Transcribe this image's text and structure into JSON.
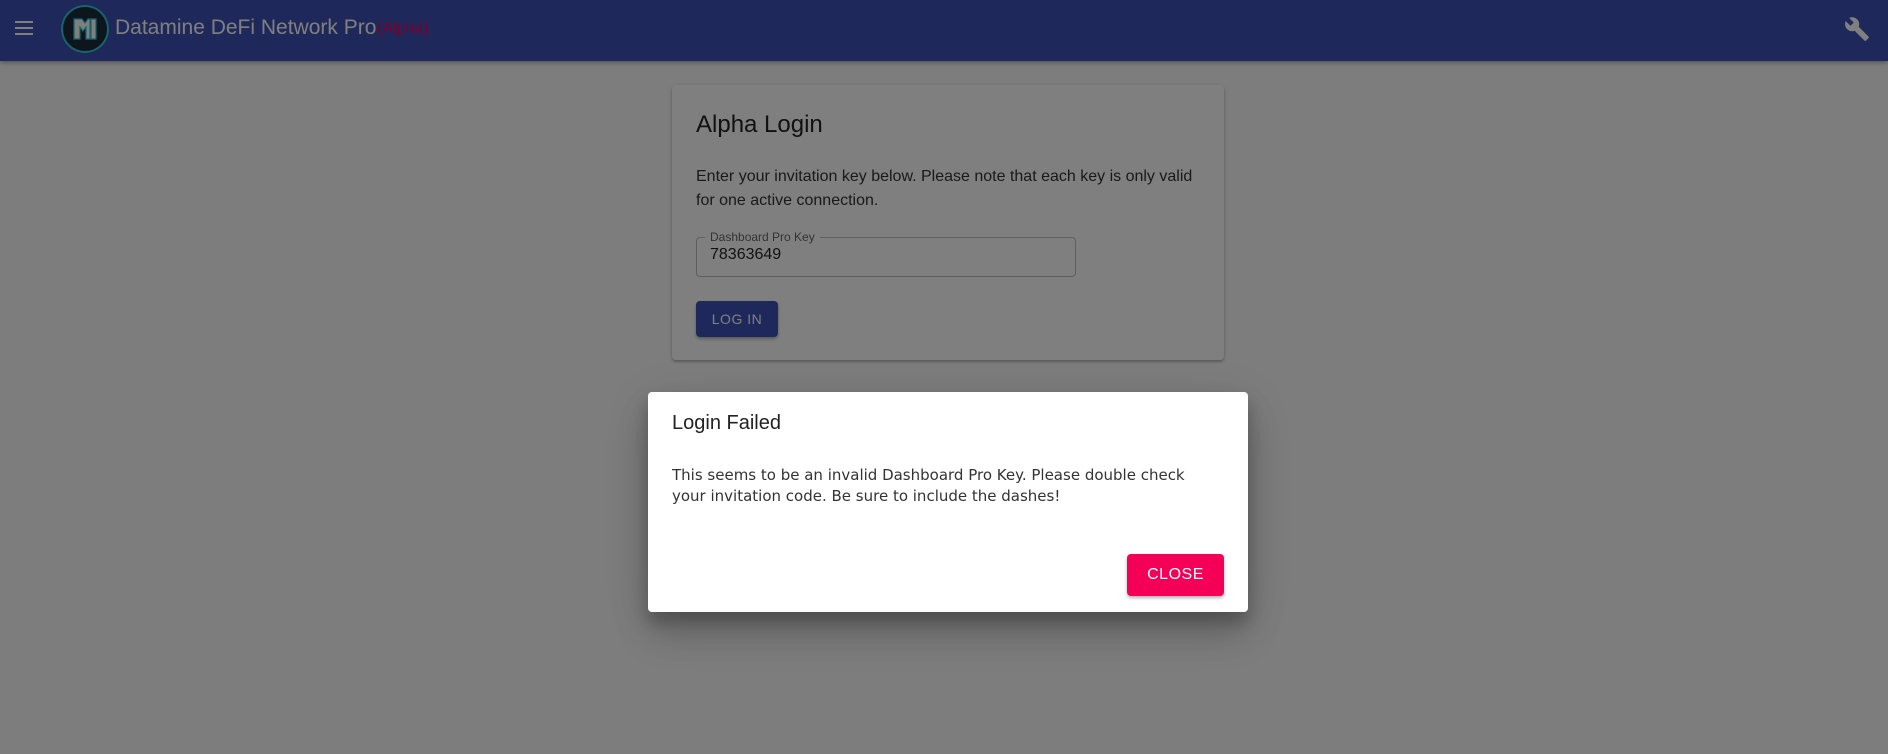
{
  "appbar": {
    "title": "Datamine DeFi Network Pro",
    "badge": "(Alpha)",
    "menu_icon": "menu-icon",
    "logo_icon": "datamine-logo-icon",
    "settings_icon": "wrench-icon",
    "color": "#3f51b5",
    "badge_color": "#f50057"
  },
  "login_card": {
    "title": "Alpha Login",
    "description": "Enter your invitation key below. Please note that each key is only valid for one active connection.",
    "key_field": {
      "label": "Dashboard Pro Key",
      "value": "78363649"
    },
    "login_button_label": "LOG IN"
  },
  "dialog": {
    "title": "Login Failed",
    "message": "This seems to be an invalid Dashboard Pro Key. Please double check your invitation code. Be sure to include the dashes!",
    "close_button_label": "CLOSE",
    "close_button_color": "#f50057"
  }
}
